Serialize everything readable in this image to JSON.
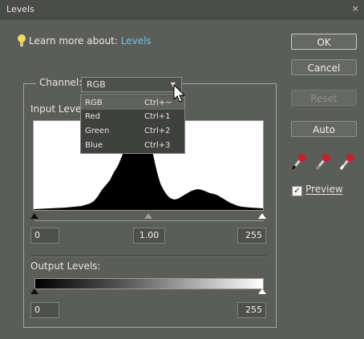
{
  "window": {
    "title": "Levels",
    "close_glyph": "×"
  },
  "learn_more": {
    "icon": "lightbulb-icon",
    "prefix": "Learn more about:",
    "link": "Levels"
  },
  "buttons": {
    "ok": "OK",
    "cancel": "Cancel",
    "reset": "Reset",
    "auto": "Auto"
  },
  "eyedroppers": [
    "black-eyedropper-icon",
    "gray-eyedropper-icon",
    "white-eyedropper-icon"
  ],
  "preview": {
    "label": "Preview",
    "checked": true,
    "check_glyph": "✓"
  },
  "channel": {
    "label": "Channel:",
    "selected": "RGB",
    "options": [
      {
        "name": "RGB",
        "shortcut": "Ctrl+~"
      },
      {
        "name": "Red",
        "shortcut": "Ctrl+1"
      },
      {
        "name": "Green",
        "shortcut": "Ctrl+2"
      },
      {
        "name": "Blue",
        "shortcut": "Ctrl+3"
      }
    ]
  },
  "input_levels": {
    "label": "Input Levels:",
    "visible_label": "Input Leve",
    "black": "0",
    "gamma": "1.00",
    "white": "255"
  },
  "output_levels": {
    "label": "Output Levels:",
    "black": "0",
    "white": "255"
  },
  "colors": {
    "background": "#5b5d59",
    "link": "#6fc3e8",
    "histogram": "#000000"
  }
}
